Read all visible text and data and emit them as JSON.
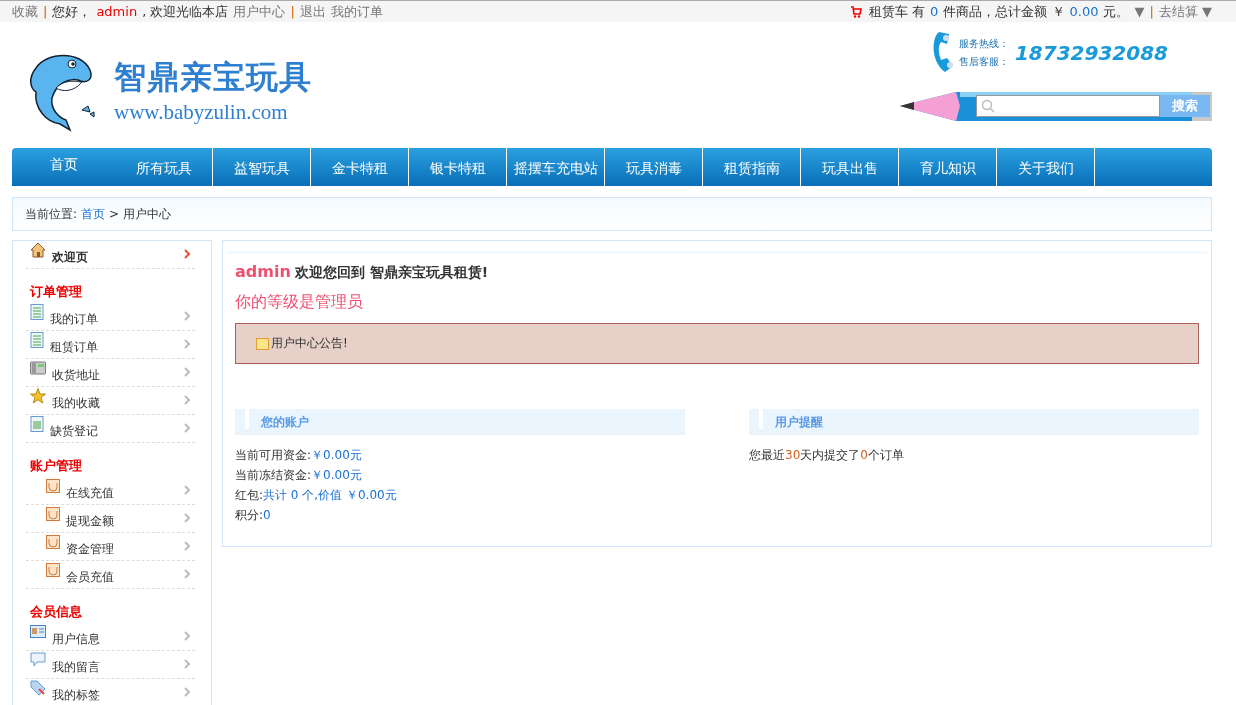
{
  "top_bar": {
    "left": [
      {
        "text": "收藏",
        "kind": "link"
      },
      {
        "text": "|",
        "kind": "sep"
      },
      {
        "text": "您好，",
        "kind": "text"
      },
      {
        "text": "admin",
        "kind": "user"
      },
      {
        "text": ", 欢迎光临本店",
        "kind": "text"
      },
      {
        "text": "用户中心",
        "kind": "link"
      },
      {
        "text": "|",
        "kind": "sep"
      },
      {
        "text": "退出",
        "kind": "link"
      },
      {
        "text": "我的订单",
        "kind": "link"
      }
    ],
    "cart": [
      {
        "text": "租赁车 有",
        "kind": "text"
      },
      {
        "text": "0",
        "kind": "value"
      },
      {
        "text": "件商品，总计金额 ￥",
        "kind": "text"
      },
      {
        "text": "0.00",
        "kind": "value"
      },
      {
        "text": "元。",
        "kind": "text"
      },
      {
        "text": "▼",
        "kind": "link"
      },
      {
        "text": "|",
        "kind": "sep"
      },
      {
        "text": "去结算 ▼",
        "kind": "link"
      }
    ]
  },
  "header": {
    "logo_name": "智鼎亲宝玩具",
    "logo_url": "www.babyzulin.com",
    "hotline_labels": [
      "服务热线：",
      "售后客服："
    ],
    "phone": "18732932088",
    "search_button": "搜索"
  },
  "nav": [
    {
      "label": "首页"
    },
    {
      "label": "所有玩具"
    },
    {
      "label": "益智玩具"
    },
    {
      "label": "金卡特租"
    },
    {
      "label": "银卡特租"
    },
    {
      "label": "摇摆车充电站"
    },
    {
      "label": "玩具消毒"
    },
    {
      "label": "租赁指南"
    },
    {
      "label": "玩具出售"
    },
    {
      "label": "育儿知识"
    },
    {
      "label": "关于我们"
    }
  ],
  "breadcrumb": {
    "label": "当前位置:",
    "home": "首页",
    "sep": ">",
    "current": "用户中心"
  },
  "sidebar": [
    {
      "items": [
        {
          "label": "欢迎页",
          "kind": "house",
          "selected": true
        }
      ]
    },
    {
      "title": "订单管理",
      "items": [
        {
          "label": "我的订单",
          "kind": "doc",
          "selected": false
        },
        {
          "label": "租赁订单",
          "kind": "doc",
          "selected": false
        },
        {
          "label": "收货地址",
          "kind": "phone",
          "selected": false
        },
        {
          "label": "我的收藏",
          "kind": "star",
          "selected": false
        },
        {
          "label": "缺货登记",
          "kind": "sheet",
          "selected": false
        }
      ]
    },
    {
      "title": "账户管理",
      "items": [
        {
          "label": "在线充值",
          "kind": "pocket",
          "selected": false
        },
        {
          "label": "提现金额",
          "kind": "pocket",
          "selected": false
        },
        {
          "label": "资金管理",
          "kind": "pocket",
          "selected": false
        },
        {
          "label": "会员充值",
          "kind": "pocket",
          "selected": false
        }
      ]
    },
    {
      "title": "会员信息",
      "items": [
        {
          "label": "用户信息",
          "kind": "card",
          "selected": false
        },
        {
          "label": "我的留言",
          "kind": "bubble",
          "selected": false
        },
        {
          "label": "我的标签",
          "kind": "tag",
          "selected": false
        }
      ]
    }
  ],
  "main": {
    "user": "admin",
    "welcome": "欢迎您回到 智鼎亲宝玩具租赁!",
    "level_text": "你的等级是管理员",
    "notice": "用户中心公告!",
    "account": {
      "title": "您的账户",
      "lines": [
        [
          {
            "text": "当前可用资金:",
            "kind": "label"
          },
          {
            "text": "￥0.00元",
            "kind": "value"
          }
        ],
        [
          {
            "text": "当前冻结资金:",
            "kind": "label"
          },
          {
            "text": "￥0.00元",
            "kind": "value"
          }
        ],
        [
          {
            "text": "红包:",
            "kind": "label"
          },
          {
            "text": "共计 0 个,价值 ￥0.00元",
            "kind": "value"
          }
        ],
        [
          {
            "text": "积分:",
            "kind": "label"
          },
          {
            "text": "0",
            "kind": "value"
          }
        ]
      ]
    },
    "reminder": {
      "title": "用户提醒",
      "parts": [
        {
          "text": "您最近",
          "kind": "label"
        },
        {
          "text": "30",
          "kind": "num"
        },
        {
          "text": "天内提交了",
          "kind": "label"
        },
        {
          "text": "0",
          "kind": "num"
        },
        {
          "text": "个订单",
          "kind": "label"
        }
      ]
    }
  }
}
